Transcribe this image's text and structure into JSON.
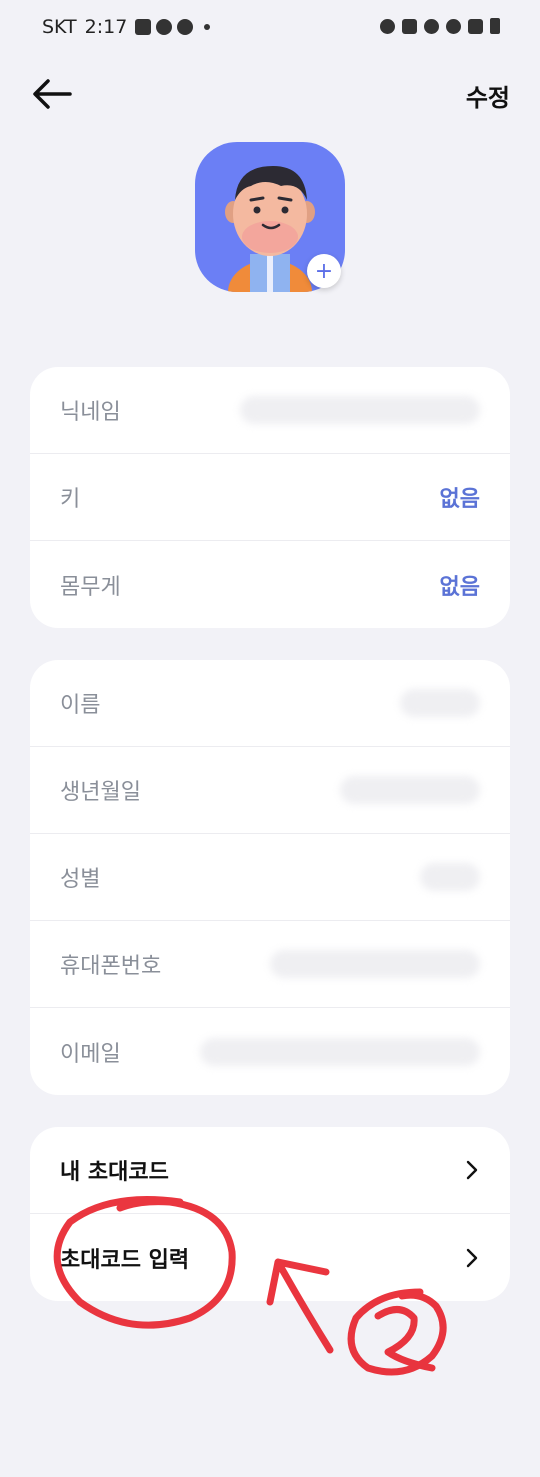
{
  "status_bar": {
    "carrier": "SKT",
    "time": "2:17"
  },
  "header": {
    "edit_label": "수정"
  },
  "body_info": {
    "nickname_label": "닉네임",
    "height_label": "키",
    "height_value": "없음",
    "weight_label": "몸무게",
    "weight_value": "없음"
  },
  "personal_info": {
    "name_label": "이름",
    "birthdate_label": "생년월일",
    "gender_label": "성별",
    "phone_label": "휴대폰번호",
    "email_label": "이메일"
  },
  "invite": {
    "my_code_label": "내 초대코드",
    "enter_code_label": "초대코드 입력"
  },
  "colors": {
    "accent": "#5b73d6",
    "avatar_bg": "#6b7ff5",
    "annotation": "#e8202a"
  }
}
